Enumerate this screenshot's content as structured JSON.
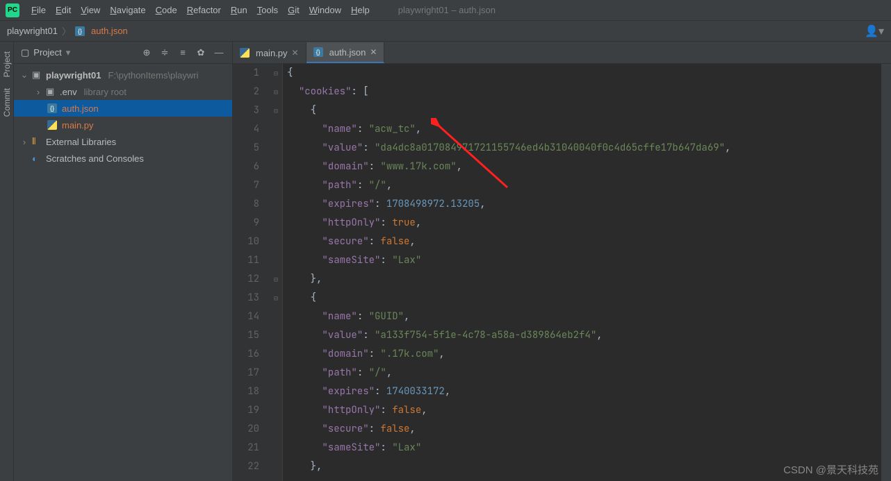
{
  "title": "playwright01 – auth.json",
  "menus": [
    "File",
    "Edit",
    "View",
    "Navigate",
    "Code",
    "Refactor",
    "Run",
    "Tools",
    "Git",
    "Window",
    "Help"
  ],
  "breadcrumb": {
    "project": "playwright01",
    "file": "auth.json"
  },
  "panel": {
    "title": "Project",
    "root": "playwright01",
    "rootPath": "F:\\pythonItems\\playwri",
    "env": ".env",
    "envHint": "library root",
    "files": [
      "auth.json",
      "main.py"
    ],
    "external": "External Libraries",
    "scratches": "Scratches and Consoles"
  },
  "tabs": [
    {
      "label": "main.py",
      "active": false
    },
    {
      "label": "auth.json",
      "active": true
    }
  ],
  "leftTabs": [
    "Project",
    "Commit"
  ],
  "code": {
    "lines": [
      {
        "n": 1,
        "t": "{"
      },
      {
        "n": 2,
        "t": "  \"cookies\": ["
      },
      {
        "n": 3,
        "t": "    {"
      },
      {
        "n": 4,
        "t": "      \"name\": \"acw_tc\","
      },
      {
        "n": 5,
        "t": "      \"value\": \"da4dc8a017084971721155746ed4b31040040f0c4d65cffe17b647da69\","
      },
      {
        "n": 6,
        "t": "      \"domain\": \"www.17k.com\","
      },
      {
        "n": 7,
        "t": "      \"path\": \"/\","
      },
      {
        "n": 8,
        "t": "      \"expires\": 1708498972.13205,"
      },
      {
        "n": 9,
        "t": "      \"httpOnly\": true,"
      },
      {
        "n": 10,
        "t": "      \"secure\": false,"
      },
      {
        "n": 11,
        "t": "      \"sameSite\": \"Lax\""
      },
      {
        "n": 12,
        "t": "    },"
      },
      {
        "n": 13,
        "t": "    {"
      },
      {
        "n": 14,
        "t": "      \"name\": \"GUID\","
      },
      {
        "n": 15,
        "t": "      \"value\": \"a133f754-5f1e-4c78-a58a-d389864eb2f4\","
      },
      {
        "n": 16,
        "t": "      \"domain\": \".17k.com\","
      },
      {
        "n": 17,
        "t": "      \"path\": \"/\","
      },
      {
        "n": 18,
        "t": "      \"expires\": 1740033172,"
      },
      {
        "n": 19,
        "t": "      \"httpOnly\": false,"
      },
      {
        "n": 20,
        "t": "      \"secure\": false,"
      },
      {
        "n": 21,
        "t": "      \"sameSite\": \"Lax\""
      },
      {
        "n": 22,
        "t": "    },"
      }
    ]
  },
  "watermark": "CSDN @景天科技苑"
}
